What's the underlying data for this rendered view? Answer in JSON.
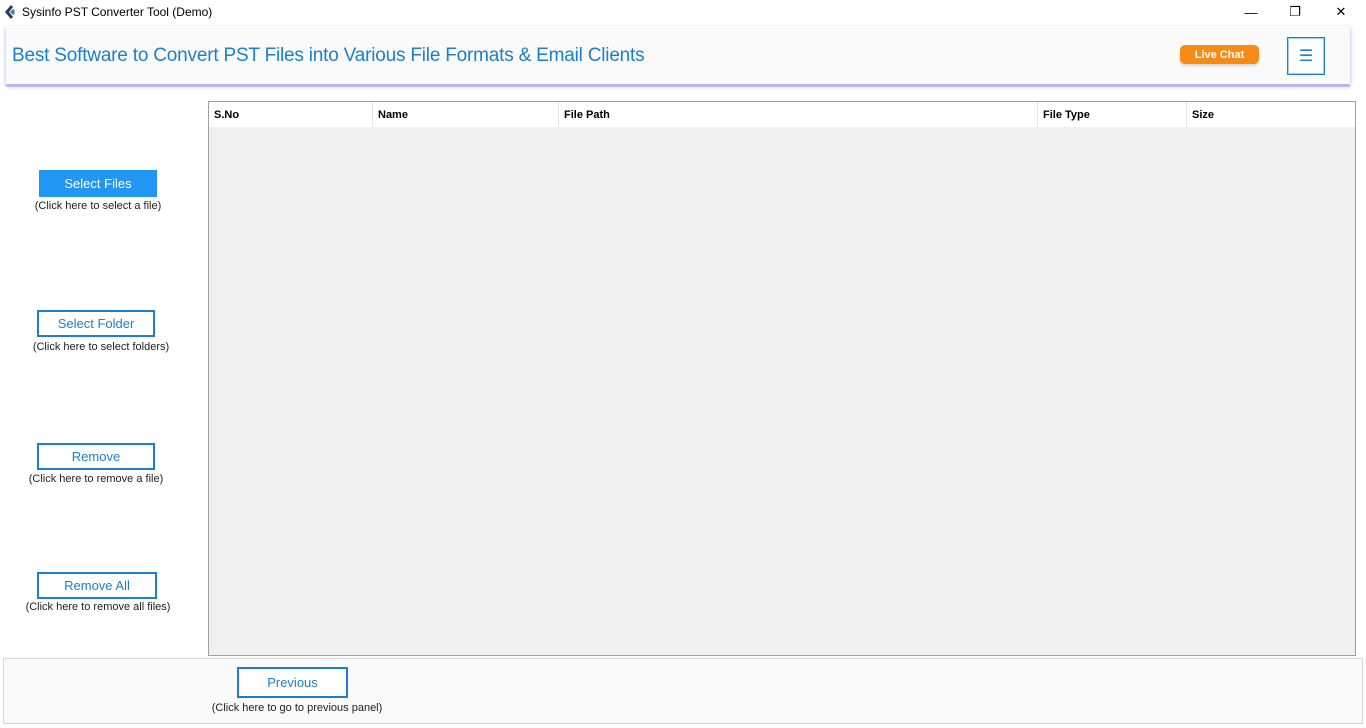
{
  "window": {
    "title": "Sysinfo PST Converter Tool (Demo)",
    "minimize_glyph": "—",
    "maximize_glyph": "❐",
    "close_glyph": "✕"
  },
  "header": {
    "title": "Best Software to Convert PST Files into Various File Formats & Email Clients",
    "live_chat": "Live Chat",
    "menu_glyph": "☰"
  },
  "sidebar": {
    "select_files": {
      "label": "Select Files",
      "hint": "(Click here to select a file)"
    },
    "select_folder": {
      "label": "Select Folder",
      "hint": "(Click here to select folders)"
    },
    "remove": {
      "label": "Remove",
      "hint": "(Click here to remove a file)"
    },
    "remove_all": {
      "label": "Remove All",
      "hint": "(Click here to remove all files)"
    }
  },
  "table": {
    "columns": [
      "S.No",
      "Name",
      "File Path",
      "File Type",
      "Size"
    ],
    "rows": []
  },
  "footer": {
    "previous": {
      "label": "Previous",
      "hint": "(Click here to go to previous panel)"
    }
  },
  "colors": {
    "accent": "#1a7fd0",
    "primary_button": "#2196f3",
    "live_chat": "#f68b16"
  }
}
